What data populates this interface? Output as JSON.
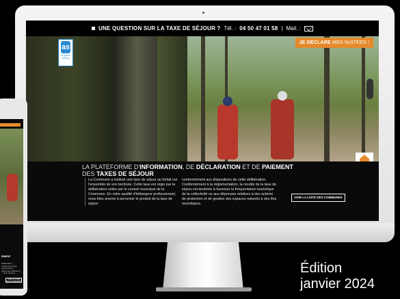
{
  "topbar": {
    "question": "UNE QUESTION SUR LA TAXE DE SÉJOUR ?",
    "tel_label": "Tél. :",
    "phone": "04 50 47 01 58",
    "separator": "|",
    "mail_label": "Mail. :"
  },
  "hero": {
    "cta_bold": "JE DÉCLARE",
    "cta_light": "MES NUITÉES !",
    "logo_mark": "as",
    "logo_text": "le grand annecy"
  },
  "headline": {
    "part1": "LA PLATEFORME D'",
    "bold1": "INFORMATION",
    "part2": ", DE ",
    "bold2": "DÉCLARATION",
    "part3": " ET DE ",
    "bold3": "PAIEMENT",
    "part4": "DES ",
    "bold4": "TAXES DE SÉJOUR"
  },
  "body": {
    "col1": "La Commune a institué une taxe de séjour au forfait sur l'ensemble de son territoire. Cette taxe est régie par la délibération votée par le conseil municipal de la Commune. En votre qualité d'hébergeur professionnel, vous êtes amené à percevoir le produit de la taxe de séjour",
    "col2": "conformément aux dispositions de cette délibération. Conformément à la réglementation, la recette de la taxe de séjour est destinée à favoriser la fréquentation touristique de la collectivité ou aux dépenses relatives à des actions de protection et de gestion des espaces naturels à des fins touristiques."
  },
  "buttons": {
    "list_communes": "VOIR LA LISTE DES COMMUNES"
  },
  "badge": {
    "label": "TAXE DE SÉJOUR"
  },
  "phone": {
    "label": "EMENT",
    "text": "délibération. ..., recette de la taxe fréquentation ... dépenses relatives à ... des espaces",
    "button": "VOIR LA LISTE DES COMMUNES"
  },
  "edition": {
    "line1": "Édition",
    "line2": "janvier 2024"
  }
}
